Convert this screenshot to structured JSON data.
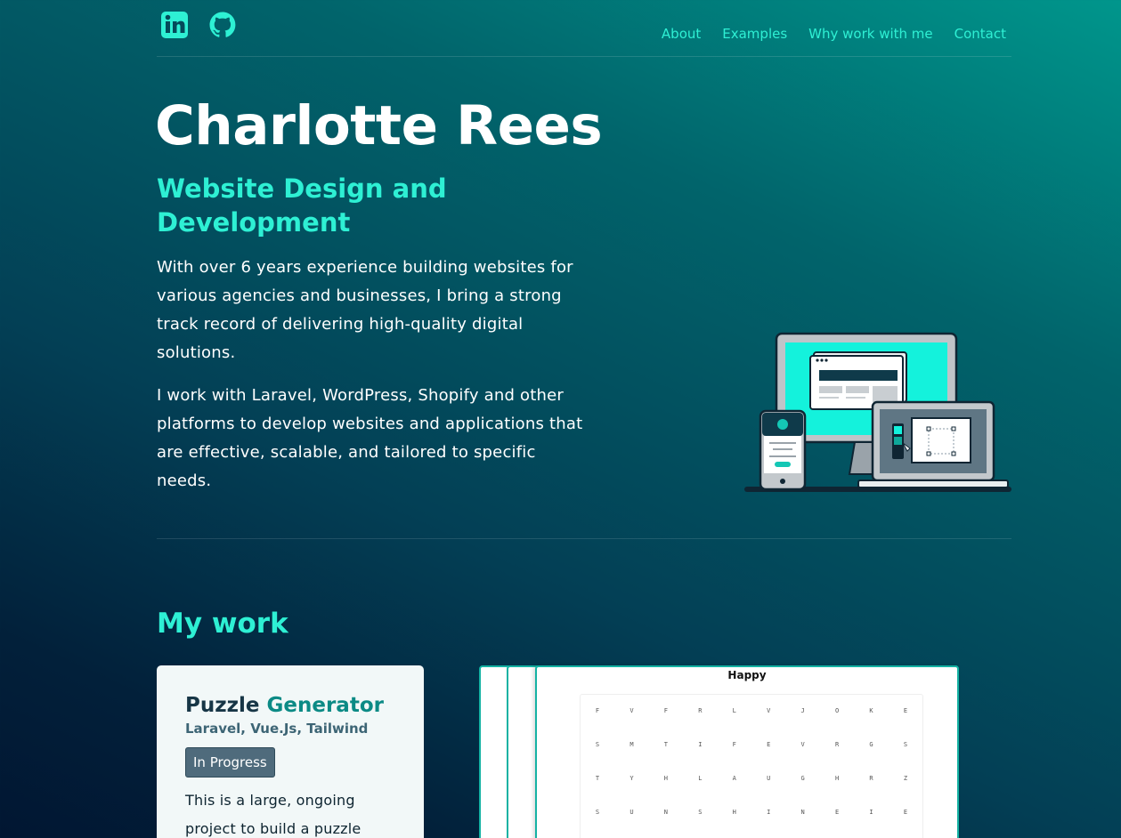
{
  "header": {
    "social": [
      {
        "icon": "linkedin-icon"
      },
      {
        "icon": "github-icon"
      }
    ],
    "nav": [
      "About",
      "Examples",
      "Why work with me",
      "Contact"
    ]
  },
  "hero": {
    "name": "Charlotte Rees",
    "subtitle": "Website Design and Development",
    "paragraph1": "With over 6 years experience building websites for various agencies and businesses, I bring a strong track record of delivering high-quality digital solutions.",
    "paragraph2": "I work with Laravel, WordPress, Shopify and other platforms to develop websites and applications that are effective, scalable, and tailored to specific needs.",
    "illustration": "devices-illustration"
  },
  "work": {
    "title": "My work",
    "project": {
      "title_part1": "Puzzle",
      "title_part2": "Generator",
      "tech": "Laravel, Vue.Js, Tailwind",
      "status": "In Progress",
      "description": "This is a large, ongoing project to build a puzzle"
    },
    "preview": {
      "puzzle_title": "Happy",
      "rows": [
        [
          "F",
          "V",
          "F",
          "R",
          "L",
          "V",
          "J",
          "O",
          "K",
          "E"
        ],
        [
          "S",
          "M",
          "T",
          "I",
          "F",
          "E",
          "V",
          "R",
          "G",
          "S"
        ],
        [
          "T",
          "Y",
          "H",
          "L",
          "A",
          "U",
          "G",
          "H",
          "R",
          "Z"
        ],
        [
          "S",
          "U",
          "N",
          "S",
          "H",
          "I",
          "N",
          "E",
          "I",
          "E"
        ]
      ]
    }
  },
  "colors": {
    "accent": "#2ef0d4",
    "card_bg": "#f2f8f8",
    "badge_bg": "#4f6b7c"
  }
}
